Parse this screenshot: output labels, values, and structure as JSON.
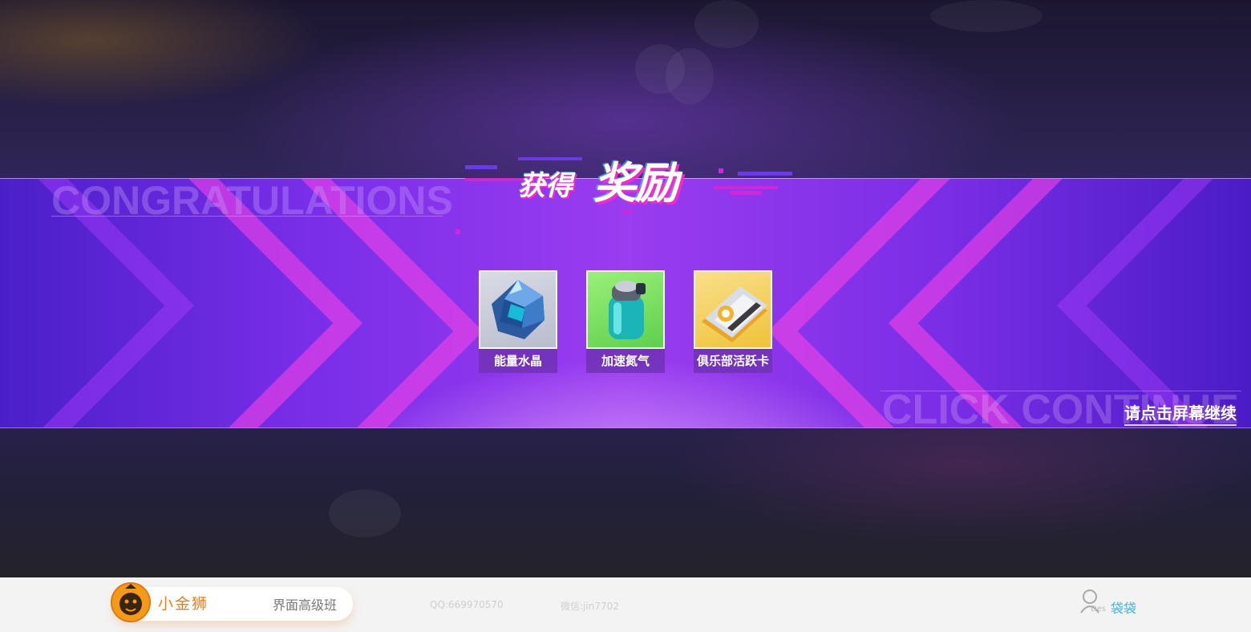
{
  "banner": {
    "title_small": "获得",
    "title_big": "奖励",
    "bg_word_top": "CONGRATULATIONS",
    "bg_word_bottom": "CLICK CONTINUE",
    "continue_hint": "请点击屏幕继续"
  },
  "rewards": [
    {
      "label": "能量水晶",
      "icon": "crystal-icon"
    },
    {
      "label": "加速氮气",
      "icon": "nitro-canister-icon"
    },
    {
      "label": "俱乐部活跃卡",
      "icon": "club-card-icon"
    }
  ],
  "footer": {
    "brand_name": "小金狮",
    "course": "界面高级班",
    "qq": "QQ:669970570",
    "wechat": "微信:jin7702",
    "user_sub": "Des",
    "user_name": "袋袋"
  },
  "colors": {
    "banner_purple": "#8a35ee",
    "accent_pink": "#ff46e6",
    "brand_orange": "#ef7c16",
    "user_blue": "#3bb3e8"
  }
}
